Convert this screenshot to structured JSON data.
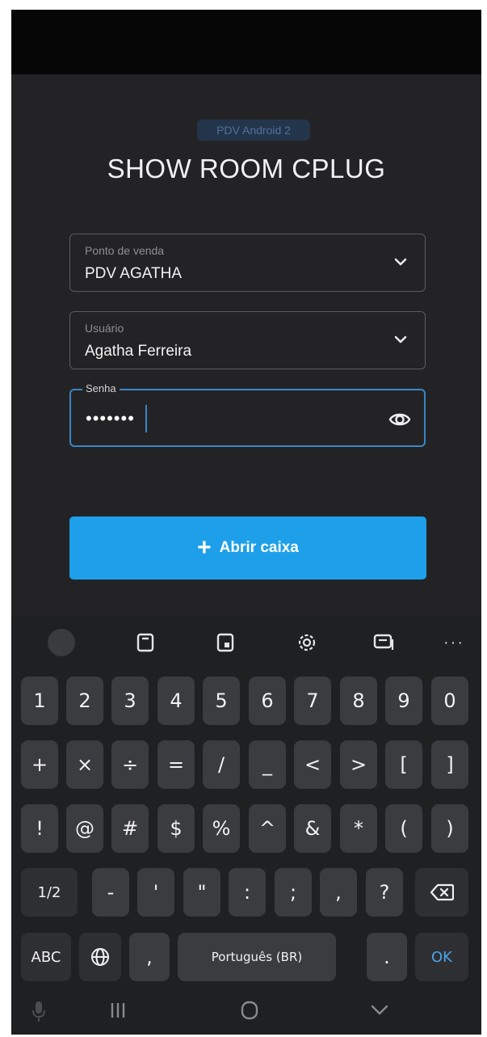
{
  "app": {
    "version_badge": "PDV Android 2",
    "store_title": "SHOW ROOM CPLUG"
  },
  "form": {
    "pdv_field": {
      "label": "Ponto de venda",
      "value": "PDV AGATHA"
    },
    "user_field": {
      "label": "Usuário",
      "value": "Agatha Ferreira"
    },
    "password_field": {
      "label": "Senha",
      "value": "•••••••"
    }
  },
  "actions": {
    "open_cash_label": "Abrir caixa",
    "open_cash_icon": "plus-icon"
  },
  "keyboard": {
    "toolbar_icons": [
      "emoji-icon",
      "clipboard-icon",
      "sticker-icon",
      "gear-icon",
      "screen-icon",
      "more-icon"
    ],
    "more_label": "···",
    "row1": [
      "1",
      "2",
      "3",
      "4",
      "5",
      "6",
      "7",
      "8",
      "9",
      "0"
    ],
    "row2": [
      "+",
      "×",
      "÷",
      "=",
      "/",
      "_",
      "<",
      ">",
      "[",
      "]"
    ],
    "row3": [
      "!",
      "@",
      "#",
      "$",
      "%",
      "^",
      "&",
      "*",
      "(",
      ")"
    ],
    "row4": [
      "1/2",
      "-",
      "'",
      "\"",
      ":",
      ";",
      ",",
      "?"
    ],
    "row5": {
      "abc": "ABC",
      "comma": ",",
      "space": "Português (BR)",
      "period": ".",
      "ok": "OK"
    }
  },
  "colors": {
    "accent": "#1da0e9",
    "focus_border": "#3b86c4",
    "background": "#232326"
  }
}
